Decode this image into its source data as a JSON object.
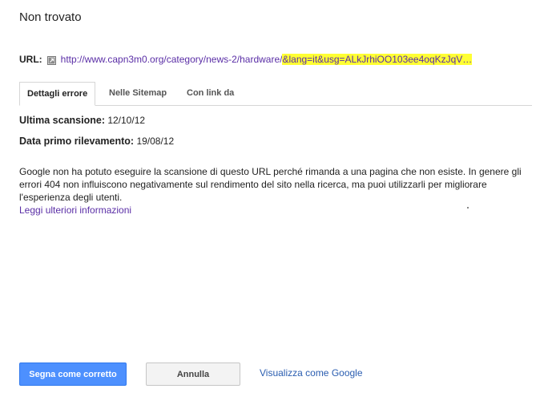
{
  "dialog": {
    "title": "Non trovato",
    "url_label": "URL:",
    "url_prefix": "http://www.capn3m0.org/category/news-2/hardware/",
    "url_highlight": "&lang=it&usg=ALkJrhiOO103ee4oqKzJqV…"
  },
  "tabs": [
    {
      "label": "Dettagli errore",
      "active": true
    },
    {
      "label": "Nelle Sitemap",
      "active": false
    },
    {
      "label": "Con link da",
      "active": false
    }
  ],
  "details": {
    "last_scan_label": "Ultima scansione:",
    "last_scan_value": "12/10/12",
    "first_detect_label": "Data primo rilevamento:",
    "first_detect_value": "19/08/12",
    "description": "Google non ha potuto eseguire la scansione di questo URL perché rimanda a una pagina che non esiste. In genere gli errori 404 non influiscono negativamente sul rendimento del sito nella ricerca, ma puoi utilizzarli per migliorare l'esperienza degli utenti.",
    "more_info": "Leggi ulteriori informazioni"
  },
  "actions": {
    "mark_fixed": "Segna come corretto",
    "cancel": "Annulla",
    "fetch_as_google": "Visualizza come Google"
  },
  "colors": {
    "primary_button": "#4d90fe",
    "link_visited": "#5a2ea6",
    "highlight": "#ffff33"
  },
  "icons": {
    "external_link": "external-link-icon"
  }
}
